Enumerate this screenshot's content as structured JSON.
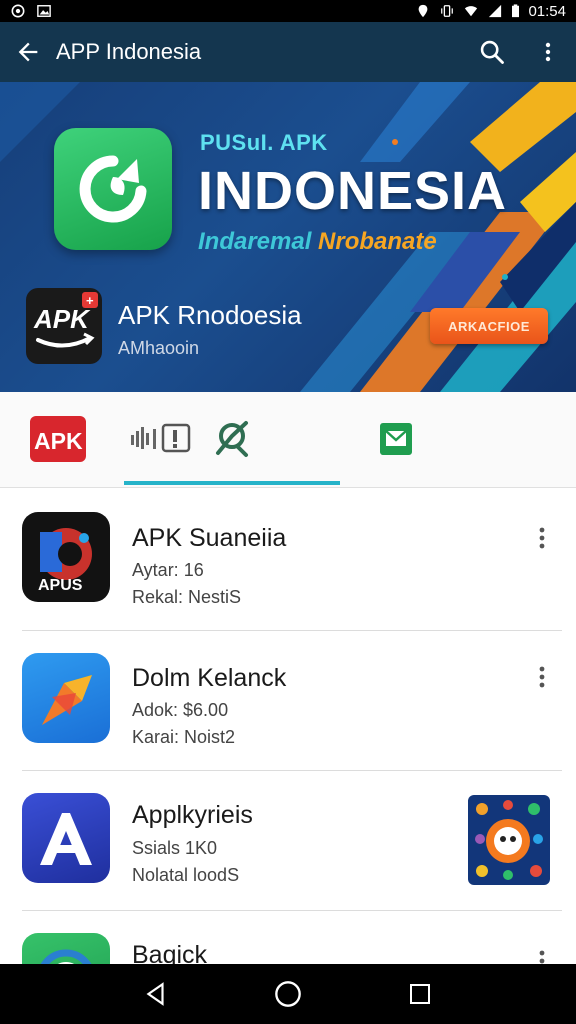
{
  "status_bar": {
    "time": "01:54"
  },
  "app_bar": {
    "title": "APP Indonesia",
    "back_icon": "arrow-back-icon",
    "search_icon": "search-icon",
    "menu_icon": "more-vert-icon",
    "bg": "#14364f"
  },
  "banner": {
    "kicker": "PUSuI. APK",
    "title": "INDONESIA",
    "subtitle_a": "Indaremal ",
    "subtitle_b": "Nrobanate",
    "app_logo_text": "APK",
    "app_badge": "+",
    "app_name": "APK Rnodoesia",
    "app_sub": "AMhaooin",
    "cta": "ARKACFIOE",
    "colors": {
      "accent_cyan": "#3ec8d8",
      "accent_orange": "#f6a623",
      "cta": "#f0641f"
    }
  },
  "tabs": {
    "items": [
      {
        "label": "APK",
        "icon": "apk-logo-icon"
      },
      {
        "label": "",
        "icon": "equalizer-icon"
      },
      {
        "label": "",
        "icon": "explore-icon"
      },
      {
        "label": "",
        "icon": "mail-icon"
      }
    ],
    "selected_index": 2,
    "indicator_color": "#26b3c9"
  },
  "list": [
    {
      "name": "APK Suaneiia",
      "line1": "Aytar: 16",
      "line2": "Rekal: NestiS",
      "icon_label": "APUS",
      "icon": "apus-app-icon"
    },
    {
      "name": "Dolm Kelanck",
      "line1": "Adok: $6.00",
      "line2": "Karai: Noist2",
      "icon": "kite-app-icon"
    },
    {
      "name": "Applkyrieis",
      "line1": "Ssials 1K0",
      "line2": "Nolatal loodS",
      "icon": "a-letter-app-icon",
      "thumb": "game-thumbnail-icon"
    },
    {
      "name": "Baqick",
      "icon": "circle-app-icon"
    }
  ],
  "nav_bar": {
    "back": "nav-back-icon",
    "home": "nav-home-icon",
    "recents": "nav-recents-icon"
  }
}
